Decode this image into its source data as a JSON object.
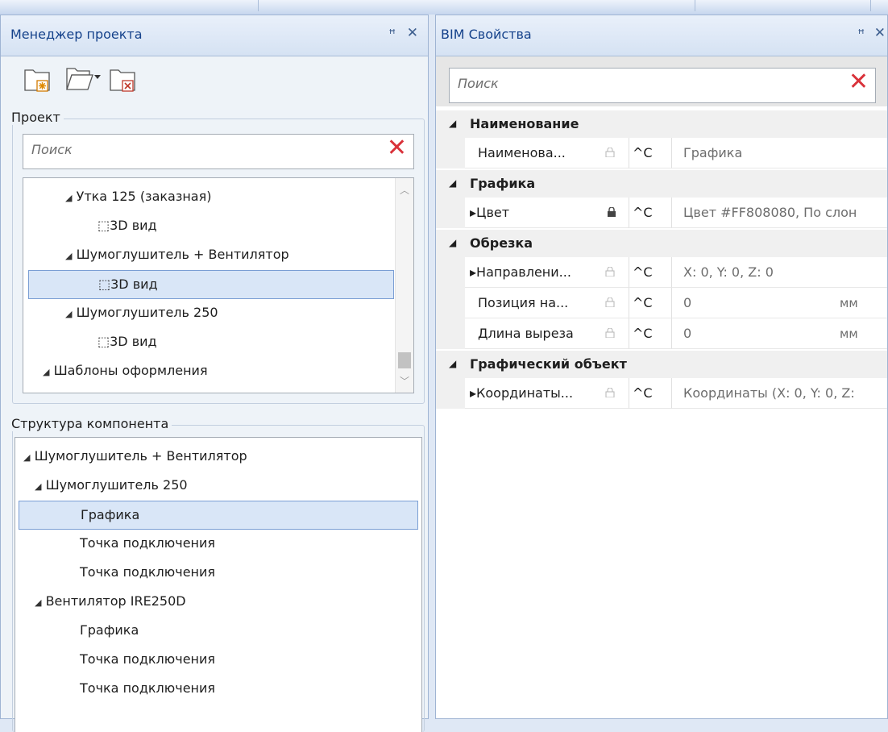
{
  "left_panel": {
    "title": "Менеджер проекта",
    "pin_glyph": "ꟸ",
    "close_glyph": "✕",
    "project_group": {
      "label": "Проект",
      "search_placeholder": "Поиск",
      "tree": [
        {
          "label": "Утка 125 (заказная)",
          "expanded": true,
          "level": 1
        },
        {
          "label": "3D вид",
          "level": 2,
          "icon": "cube-icon"
        },
        {
          "label": "Шумоглушитель + Вентилятор",
          "expanded": true,
          "level": 1
        },
        {
          "label": "3D вид",
          "level": 2,
          "icon": "cube-icon",
          "selected": true
        },
        {
          "label": "Шумоглушитель 250",
          "expanded": true,
          "level": 1
        },
        {
          "label": "3D вид",
          "level": 2,
          "icon": "cube-icon"
        },
        {
          "label": "Шаблоны оформления",
          "expanded": true,
          "level": 0
        }
      ]
    },
    "structure_group": {
      "label": "Структура компонента",
      "tree": [
        {
          "label": "Шумоглушитель + Вентилятор",
          "level": 0,
          "expanded": true
        },
        {
          "label": "Шумоглушитель 250",
          "level": 1,
          "expanded": true
        },
        {
          "label": "Графика",
          "level": 2,
          "selected": true
        },
        {
          "label": "Точка подключения",
          "level": 2
        },
        {
          "label": "Точка подключения",
          "level": 2
        },
        {
          "label": "Вентилятор IRE250D",
          "level": 1,
          "expanded": true
        },
        {
          "label": "Графика",
          "level": 2
        },
        {
          "label": "Точка подключения",
          "level": 2
        },
        {
          "label": "Точка подключения",
          "level": 2
        }
      ]
    }
  },
  "right_panel": {
    "title": "BIM Свойства",
    "pin_glyph": "ꟸ",
    "close_glyph": "✕",
    "search_placeholder": "Поиск",
    "categories": [
      {
        "name": "Наименование",
        "props": [
          {
            "name": "Наименова...",
            "locked": false,
            "flag": "^C",
            "value": "Графика",
            "unit": ""
          }
        ]
      },
      {
        "name": "Графика",
        "props": [
          {
            "name": "Цвет",
            "expandable": true,
            "locked": true,
            "flag": "^C",
            "value": "Цвет #FF808080, По слон",
            "unit": ""
          }
        ]
      },
      {
        "name": "Обрезка",
        "props": [
          {
            "name": "Направлени...",
            "expandable": true,
            "locked": false,
            "flag": "^C",
            "value": "X: 0, Y: 0, Z: 0",
            "unit": ""
          },
          {
            "name": "Позиция на...",
            "locked": false,
            "flag": "^C",
            "value": "0",
            "unit": "мм"
          },
          {
            "name": "Длина выреза",
            "locked": false,
            "flag": "^C",
            "value": "0",
            "unit": "мм"
          }
        ]
      },
      {
        "name": "Графический объект",
        "props": [
          {
            "name": "Координаты...",
            "expandable": true,
            "locked": false,
            "flag": "^C",
            "value": "Координаты (X: 0, Y: 0, Z:",
            "unit": ""
          }
        ]
      }
    ]
  },
  "colors": {
    "accent_title": "#15428b",
    "selection_bg": "#d9e6f7",
    "selection_border": "#7a9ed4",
    "clear_x": "#d9323a"
  }
}
